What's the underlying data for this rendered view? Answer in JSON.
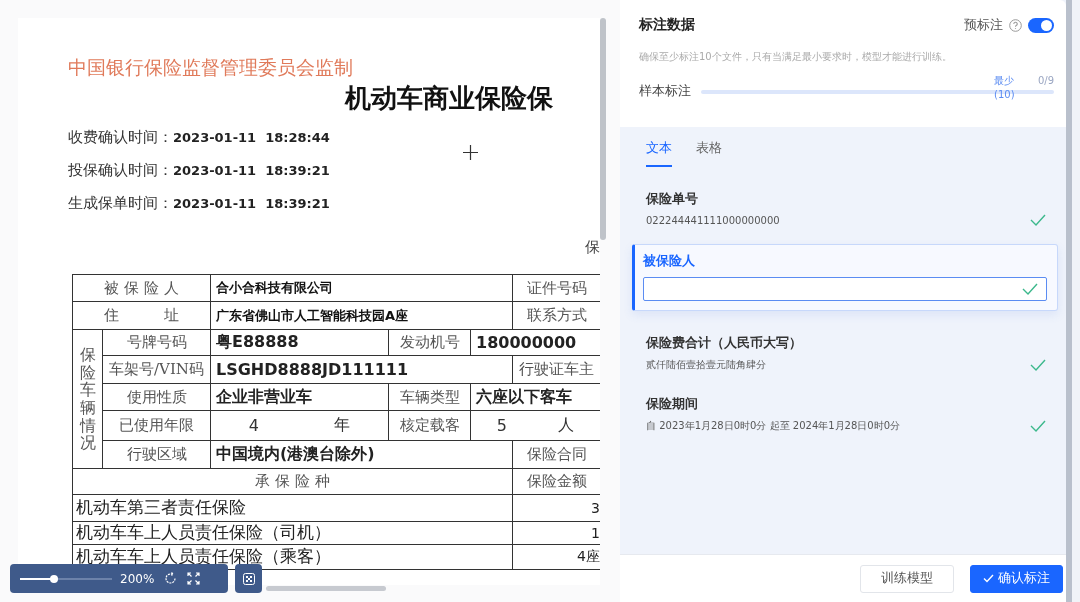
{
  "document": {
    "header": "中国银行保险监督管理委员会监制",
    "title": "机动车商业保险保",
    "times": [
      {
        "label": "收费确认时间：",
        "value": "2023-01-11  18:28:44"
      },
      {
        "label": "投保确认时间：",
        "value": "2023-01-11  18:39:21"
      },
      {
        "label": "生成保单时间：",
        "value": "2023-01-11  18:39:21"
      }
    ],
    "note": "保",
    "vehicle_label": "保险车辆情况",
    "rows": [
      {
        "cells": [
          {
            "kind": "label",
            "text": "被 保 险 人"
          },
          {
            "kind": "value",
            "text": "合小合科技有限公司"
          },
          {
            "kind": "label",
            "text": "证件号码"
          }
        ]
      },
      {
        "cells": [
          {
            "kind": "label",
            "text": "住　　　址"
          },
          {
            "kind": "value",
            "text": "广东省佛山市人工智能科技园A座"
          },
          {
            "kind": "label",
            "text": "联系方式"
          }
        ]
      },
      {
        "cells": [
          {
            "kind": "label",
            "text": "号牌号码"
          },
          {
            "kind": "big",
            "text": "粤E88888"
          },
          {
            "kind": "label",
            "text": "发动机号"
          },
          {
            "kind": "big",
            "text": "180000000"
          }
        ]
      },
      {
        "cells": [
          {
            "kind": "label",
            "text": "车架号/VIN码"
          },
          {
            "kind": "big",
            "text": "LSGHD8888JD111111"
          },
          {
            "kind": "label",
            "text": "行驶证车主"
          }
        ]
      },
      {
        "cells": [
          {
            "kind": "label",
            "text": "使用性质"
          },
          {
            "kind": "big",
            "text": "企业非营业车"
          },
          {
            "kind": "label",
            "text": "车辆类型"
          },
          {
            "kind": "big",
            "text": "六座以下客车"
          }
        ]
      },
      {
        "cells": [
          {
            "kind": "label",
            "text": "已使用年限"
          },
          {
            "kind": "unit",
            "text": "4",
            "unit": "年"
          },
          {
            "kind": "label",
            "text": "核定载客"
          },
          {
            "kind": "unit",
            "text": "5",
            "unit": "人"
          }
        ]
      },
      {
        "cells": [
          {
            "kind": "label",
            "text": "行驶区域"
          },
          {
            "kind": "big",
            "text": "中国境内(港澳台除外)"
          },
          {
            "kind": "label",
            "text": "保险合同"
          }
        ]
      },
      {
        "cells": [
          {
            "kind": "label",
            "text": "承 保 险 种"
          },
          {
            "kind": "label",
            "text": "保险金额"
          }
        ]
      },
      {
        "cells": [
          {
            "kind": "item",
            "text": "机动车第三者责任保险"
          },
          {
            "kind": "amount",
            "text": "3"
          }
        ]
      },
      {
        "cells": [
          {
            "kind": "item",
            "text": "机动车车上人员责任保险（司机）"
          },
          {
            "kind": "amount",
            "text": "1"
          }
        ]
      },
      {
        "cells": [
          {
            "kind": "item",
            "text": "机动车车上人员责任保险（乘客）"
          },
          {
            "kind": "amount",
            "text": "4座"
          }
        ]
      }
    ]
  },
  "viewer_toolbar": {
    "zoom": {
      "level": 0.37
    },
    "zoom_text": "200%"
  },
  "panel": {
    "title": "标注数据",
    "pre_label": {
      "label": "预标注",
      "on": true
    },
    "description": "确保至少标注10个文件，只有当满足最小要求时，模型才能进行训练。",
    "progress": {
      "label": "样本标注",
      "level": 0,
      "min_label": "最少",
      "min_value": "(10)",
      "count": "0/9"
    },
    "tabs": [
      {
        "label": "文本",
        "selected": true
      },
      {
        "label": "表格",
        "selected": false
      }
    ],
    "fields": [
      {
        "label": "保险单号",
        "value": "022244441111000000000",
        "selected": false
      },
      {
        "label": "被保险人",
        "selected": true
      },
      {
        "label": "保险费合计（人民币大写）",
        "value": "贰仟陆佰壹拾壹元陆角肆分",
        "selected": false
      },
      {
        "label": "保险期间",
        "value": "自 2023年1月28日0时0分 起至 2024年1月28日0时0分",
        "selected": false
      }
    ],
    "buttons": [
      {
        "label": "训练模型",
        "kind": "secondary"
      },
      {
        "label": "确认标注",
        "kind": "primary"
      }
    ]
  }
}
